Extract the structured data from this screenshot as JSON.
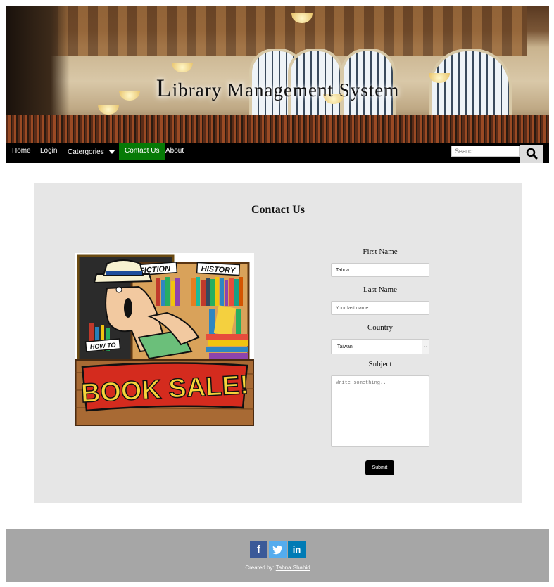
{
  "banner": {
    "title_initial": "L",
    "title_rest": "ibrary Management System"
  },
  "nav": {
    "items": [
      {
        "label": "Home"
      },
      {
        "label": "Login"
      },
      {
        "label": "Catergories"
      },
      {
        "label": "Contact Us",
        "active": true
      },
      {
        "label": "About"
      }
    ],
    "search_placeholder": "Search..",
    "search_icon": "search-icon",
    "active_color": "#067a06"
  },
  "contact": {
    "heading": "Contact Us",
    "poster": {
      "fiction": "FICTION",
      "history": "HISTORY",
      "how_to": "HOW TO",
      "sale": "BOOK SALE!"
    },
    "first_name_label": "First Name",
    "first_name_value": "Tabna",
    "last_name_label": "Last Name",
    "last_name_placeholder": "Your last name..",
    "country_label": "Country",
    "country_value": "Taiwan",
    "subject_label": "Subject",
    "subject_placeholder": "Write something..",
    "submit_label": "Submit"
  },
  "footer": {
    "social": [
      {
        "icon": "facebook-icon",
        "glyph": "f",
        "color": "#3b5998"
      },
      {
        "icon": "twitter-icon",
        "glyph": "t",
        "color": "#55acee"
      },
      {
        "icon": "linkedin-icon",
        "glyph": "in",
        "color": "#007bb5"
      }
    ],
    "credit_prefix": "Created by:",
    "credit_name": "Tabna Shahid"
  }
}
